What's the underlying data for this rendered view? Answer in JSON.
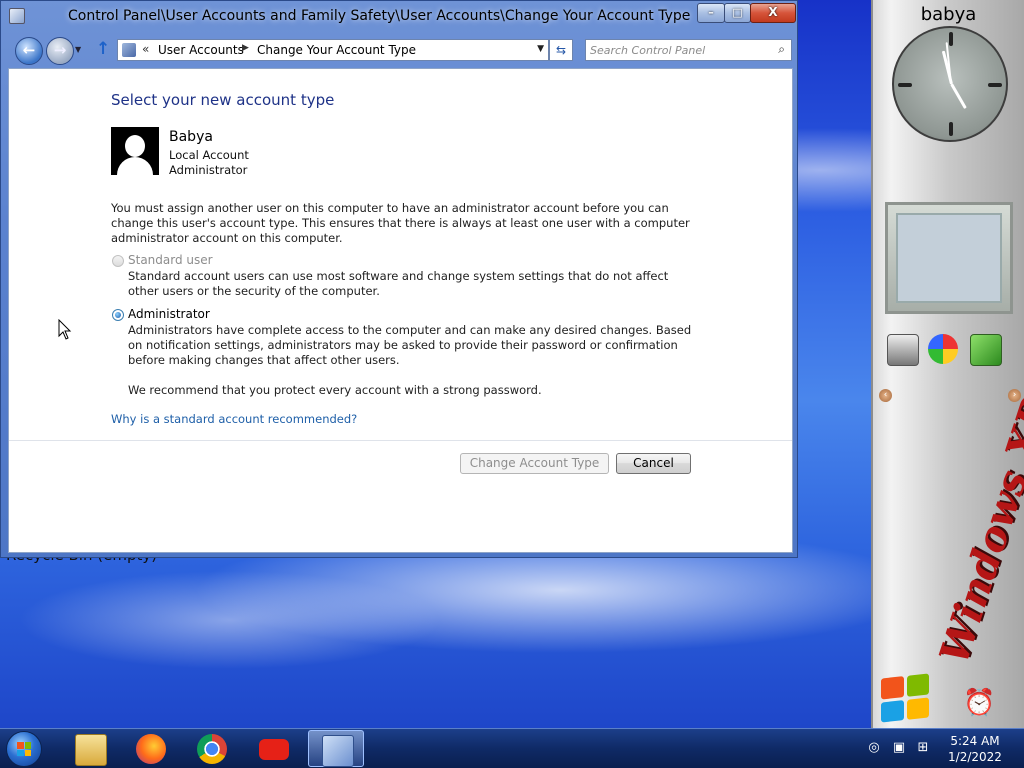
{
  "window": {
    "title": "Control Panel\\User Accounts and Family Safety\\User Accounts\\Change Your Account Type",
    "buttons": {
      "minimize": "–",
      "maximize": "□",
      "close": "X"
    }
  },
  "address_bar": {
    "overflow": "«",
    "crumbs": [
      "User Accounts",
      "Change Your Account Type"
    ]
  },
  "search": {
    "placeholder": "Search Control Panel"
  },
  "content": {
    "heading": "Select your new account type",
    "user": {
      "name": "Babya",
      "type": "Local Account",
      "role": "Administrator"
    },
    "notice": "You must assign another user on this computer to have an administrator account before you can change this user's account type. This ensures that there is always at least one user with a computer administrator account on this computer.",
    "options": [
      {
        "label": "Standard user",
        "description": "Standard account users can use most software and change system settings that do not affect other users or the security of the computer.",
        "selected": false,
        "enabled": false
      },
      {
        "label": "Administrator",
        "description": "Administrators have complete access to the computer and can make any desired changes. Based on notification settings, administrators may be asked to provide their password or confirmation before making changes that affect other users.",
        "selected": true,
        "enabled": true
      }
    ],
    "recommendation": "We recommend that you protect every account with a strong password.",
    "help_link": "Why is a standard account recommended?",
    "buttons": {
      "change": "Change Account Type",
      "cancel": "Cancel"
    }
  },
  "desktop": {
    "partial_text": "Recycle Bin (empty)"
  },
  "gadgets": {
    "user": "babya",
    "clock_icon": "analog-clock",
    "logo_text": "Windows XP"
  },
  "taskbar": {
    "pinned": [
      "file-explorer-icon",
      "firefox-icon",
      "chrome-icon",
      "youtube-icon",
      "control-panel-icon"
    ],
    "time": "5:24 AM",
    "date": "1/2/2022"
  },
  "colors": {
    "heading": "#1e3287",
    "link": "#1e5fa8",
    "taskbar": "#0f2a66"
  }
}
